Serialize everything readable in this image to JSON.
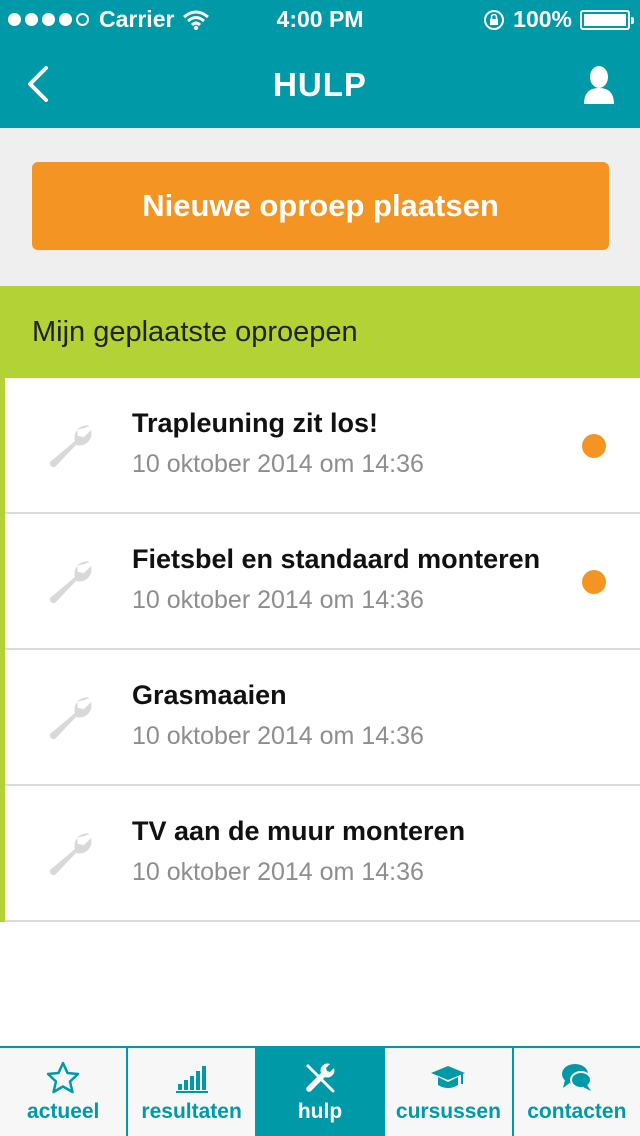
{
  "status_bar": {
    "carrier": "Carrier",
    "time": "4:00 PM",
    "battery": "100%"
  },
  "header": {
    "title": "HULP"
  },
  "cta": {
    "label": "Nieuwe oproep plaatsen"
  },
  "section": {
    "title": "Mijn geplaatste oproepen"
  },
  "requests": [
    {
      "title": "Trapleuning zit los!",
      "date": "10 oktober 2014 om 14:36",
      "unread": true
    },
    {
      "title": "Fietsbel en standaard monteren",
      "date": "10 oktober 2014 om 14:36",
      "unread": true
    },
    {
      "title": "Grasmaaien",
      "date": "10 oktober 2014 om 14:36",
      "unread": false
    },
    {
      "title": "TV aan de muur monteren",
      "date": "10 oktober 2014 om 14:36",
      "unread": false
    }
  ],
  "tabs": [
    {
      "label": "actueel",
      "icon": "star-icon",
      "active": false
    },
    {
      "label": "resultaten",
      "icon": "bar-chart-icon",
      "active": false
    },
    {
      "label": "hulp",
      "icon": "tools-icon",
      "active": true
    },
    {
      "label": "cursussen",
      "icon": "graduation-cap-icon",
      "active": false
    },
    {
      "label": "contacten",
      "icon": "chat-icon",
      "active": false
    }
  ],
  "colors": {
    "primary": "#0099a8",
    "accent": "#f49422",
    "section": "#b2d235"
  }
}
